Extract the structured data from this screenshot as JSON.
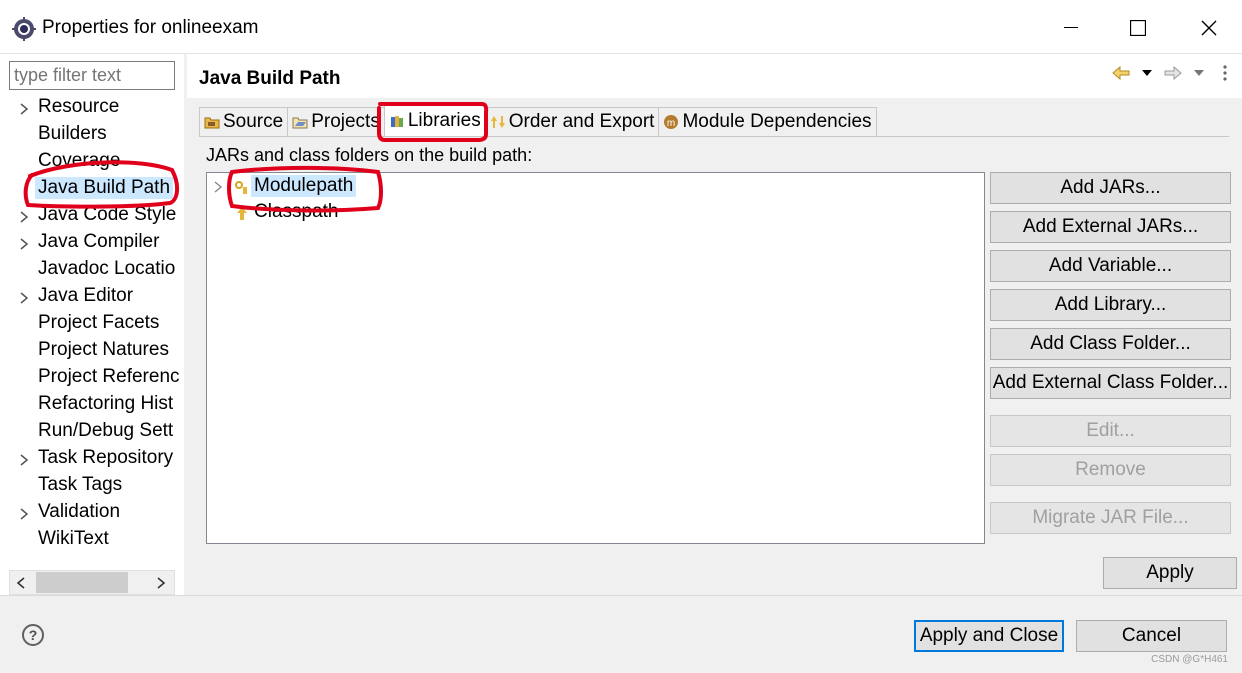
{
  "window": {
    "title": "Properties for onlineexam",
    "icon": "eclipse-gear-icon"
  },
  "sidebar": {
    "filter_placeholder": "type filter text",
    "items": [
      {
        "label": "Resource",
        "expandable": true
      },
      {
        "label": "Builders",
        "expandable": false
      },
      {
        "label": "Coverage",
        "expandable": false
      },
      {
        "label": "Java Build Path",
        "expandable": false,
        "selected": true
      },
      {
        "label": "Java Code Style",
        "expandable": true
      },
      {
        "label": "Java Compiler",
        "expandable": true
      },
      {
        "label": "Javadoc Locatio",
        "expandable": false
      },
      {
        "label": "Java Editor",
        "expandable": true
      },
      {
        "label": "Project Facets",
        "expandable": false
      },
      {
        "label": "Project Natures",
        "expandable": false
      },
      {
        "label": "Project Referenc",
        "expandable": false
      },
      {
        "label": "Refactoring Hist",
        "expandable": false
      },
      {
        "label": "Run/Debug Sett",
        "expandable": false
      },
      {
        "label": "Task Repository",
        "expandable": true
      },
      {
        "label": "Task Tags",
        "expandable": false
      },
      {
        "label": "Validation",
        "expandable": true
      },
      {
        "label": "WikiText",
        "expandable": false
      }
    ]
  },
  "main": {
    "title": "Java Build Path",
    "tabs": [
      {
        "label": "Source",
        "icon": "source-folder-icon"
      },
      {
        "label": "Projects",
        "icon": "projects-icon"
      },
      {
        "label": "Libraries",
        "icon": "libraries-icon",
        "active": true
      },
      {
        "label": "Order and Export",
        "icon": "order-export-icon"
      },
      {
        "label": "Module Dependencies",
        "icon": "module-icon"
      }
    ],
    "list_label": "JARs and class folders on the build path:",
    "entries": [
      {
        "label": "Modulepath",
        "selected": true
      },
      {
        "label": "Classpath",
        "selected": false
      }
    ],
    "buttons": [
      {
        "label": "Add JARs...",
        "enabled": true
      },
      {
        "label": "Add External JARs...",
        "enabled": true
      },
      {
        "label": "Add Variable...",
        "enabled": true
      },
      {
        "label": "Add Library...",
        "enabled": true
      },
      {
        "label": "Add Class Folder...",
        "enabled": true
      },
      {
        "label": "Add External Class Folder...",
        "enabled": true
      },
      {
        "label": "Edit...",
        "enabled": false
      },
      {
        "label": "Remove",
        "enabled": false
      },
      {
        "label": "Migrate JAR File...",
        "enabled": false
      }
    ],
    "apply_label": "Apply"
  },
  "footer": {
    "help_label": "?",
    "apply_close_label": "Apply and Close",
    "cancel_label": "Cancel",
    "watermark": "CSDN @G*H461"
  },
  "colors": {
    "selection": "#cce8ff",
    "annotation": "#e0001b",
    "default_button_border": "#0078d7"
  }
}
